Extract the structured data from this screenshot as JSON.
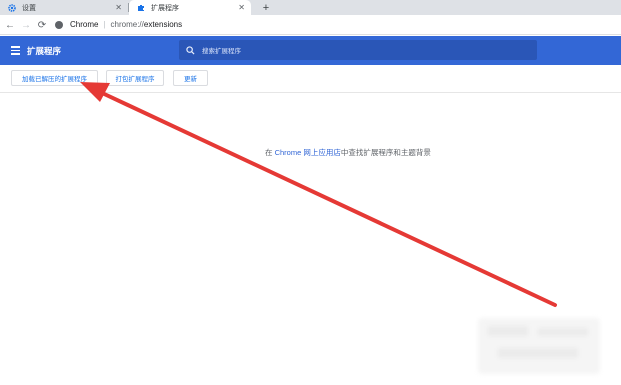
{
  "tabs": [
    {
      "label": "设置",
      "icon": "gear-icon"
    },
    {
      "label": "扩展程序",
      "icon": "puzzle-icon"
    }
  ],
  "toolbar": {
    "site_label": "Chrome",
    "url_scheme": "chrome://",
    "url_path": "extensions"
  },
  "header": {
    "title": "扩展程序",
    "search_placeholder": "搜索扩展程序"
  },
  "actions": {
    "load_unpacked": "加载已解压的扩展程序",
    "pack": "打包扩展程序",
    "update": "更新"
  },
  "main": {
    "prefix": "在 ",
    "store_link": "Chrome 网上应用店",
    "suffix": "中查找扩展程序和主题背景"
  },
  "colors": {
    "header_blue": "#3367d6",
    "arrow_red": "#e53935"
  }
}
